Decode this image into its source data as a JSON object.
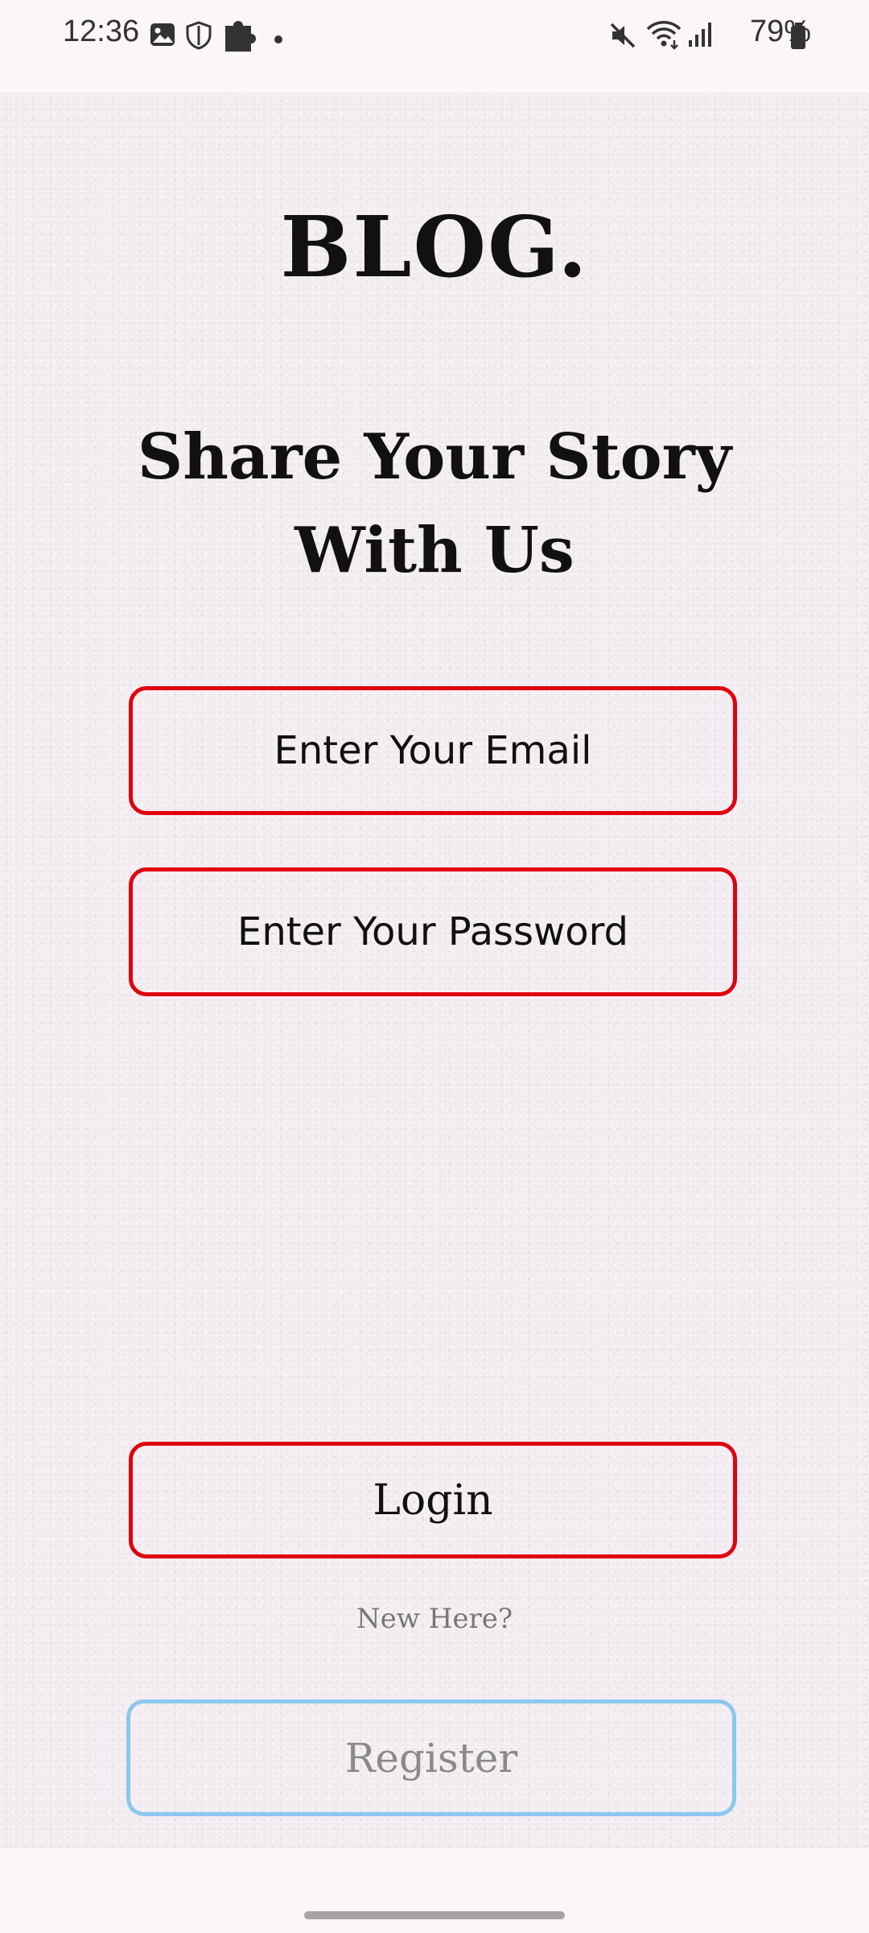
{
  "status_bar": {
    "time": "12:36",
    "battery": "79%",
    "left_icons": [
      "gallery-icon",
      "shield-icon",
      "puzzle-icon",
      "dot-icon"
    ],
    "right_icons": [
      "mute-icon",
      "wifi-icon",
      "signal-icon",
      "battery-icon"
    ]
  },
  "app": {
    "logo": "BLOG.",
    "tagline_line1": "Share Your Story",
    "tagline_line2": "With Us"
  },
  "form": {
    "email_placeholder": "Enter Your Email",
    "password_placeholder": "Enter Your Password",
    "login_label": "Login",
    "new_here_text": "New Here?",
    "register_label": "Register"
  },
  "colors": {
    "accent_red": "#e0000e",
    "register_blue": "#8cc8ee",
    "background": "#f3edf2"
  }
}
